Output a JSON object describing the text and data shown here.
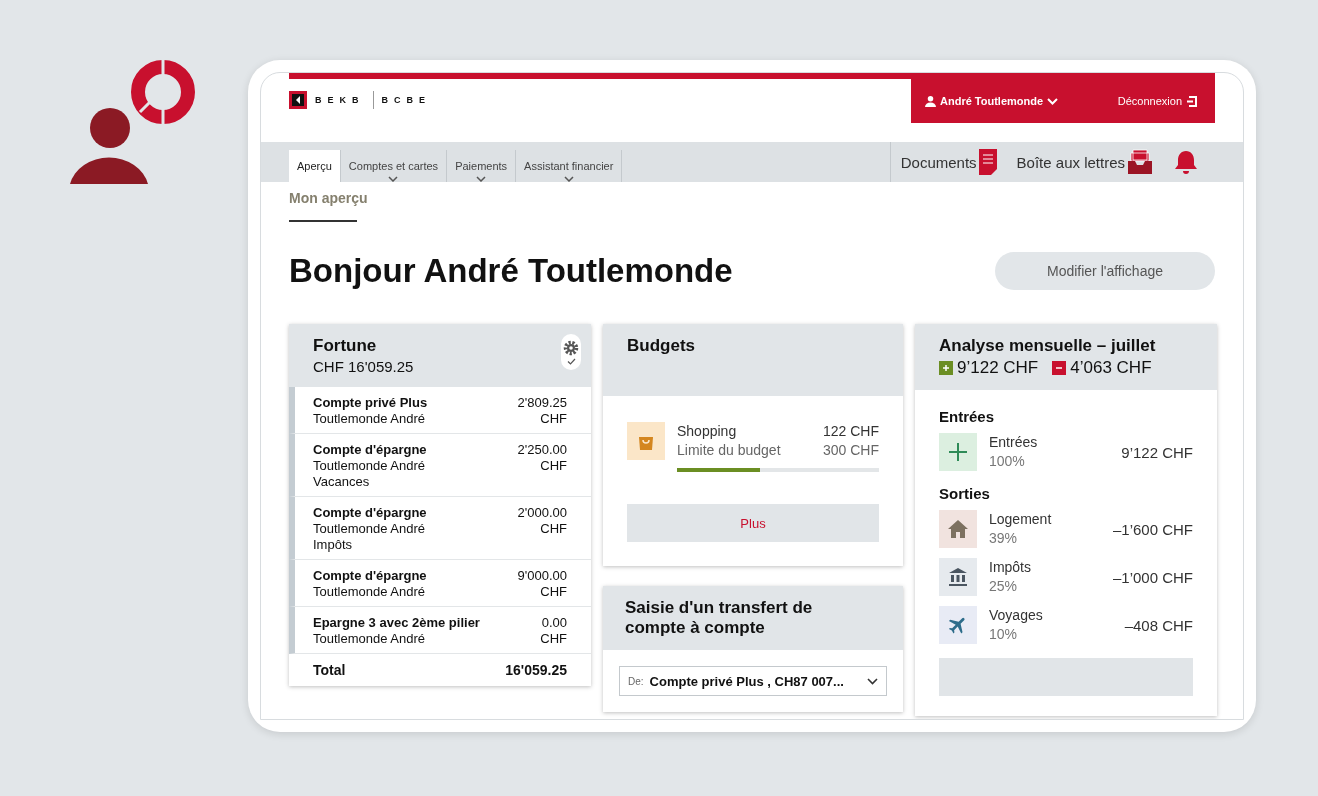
{
  "header": {
    "logo_words": [
      "BEKB",
      "BCBE"
    ],
    "user": "André Toutlemonde",
    "logout": "Déconnexion"
  },
  "nav": {
    "tabs": [
      {
        "label": "Aperçu",
        "selected": true,
        "has_menu": false
      },
      {
        "label": "Comptes et cartes",
        "selected": false,
        "has_menu": true
      },
      {
        "label": "Paiements",
        "selected": false,
        "has_menu": true
      },
      {
        "label": "Assistant financier",
        "selected": false,
        "has_menu": true
      }
    ],
    "actions": [
      {
        "kind": "documents",
        "label": "Documents"
      },
      {
        "kind": "mailbox",
        "label": "Boîte aux lettres"
      },
      {
        "kind": "notifications"
      }
    ]
  },
  "breadcrumb": "Mon aperçu",
  "greeting": "Bonjour André Toutlemonde",
  "edit_button": "Modifier l'affichage",
  "fortune": {
    "title": "Fortune",
    "total": "CHF 16'059.25",
    "accounts": [
      {
        "name": "Compte privé Plus",
        "owner": "Toutlemonde André",
        "amount": "2'809.25",
        "currency": "CHF"
      },
      {
        "name": "Compte d'épargne",
        "owner": "Toutlemonde André",
        "note": "Vacances",
        "amount": "2'250.00",
        "currency": "CHF"
      },
      {
        "name": "Compte d'épargne",
        "owner": "Toutlemonde André",
        "note": "Impôts",
        "amount": "2'000.00",
        "currency": "CHF"
      },
      {
        "name": "Compte d'épargne",
        "owner": "Toutlemonde André",
        "amount": "9'000.00",
        "currency": "CHF"
      },
      {
        "name": "Epargne 3 avec 2ème pilier",
        "owner": "Toutlemonde André",
        "amount": "0.00",
        "currency": "CHF"
      }
    ],
    "total_label": "Total",
    "total_amount": "16'059.25"
  },
  "budgets": {
    "title": "Budgets",
    "items": [
      {
        "name": "Shopping",
        "amount": "122 CHF",
        "limit_label": "Limite du budget",
        "limit": "300 CHF",
        "level": 0.41
      }
    ],
    "button": "Plus"
  },
  "transfer": {
    "title": "Saisie d'un transfert de compte à compte",
    "from_label": "De:",
    "from_value": "Compte privé Plus , CH87 007..."
  },
  "analysis": {
    "title": "Analyse mensuelle – juillet",
    "income_total": "9’122 CHF",
    "expense_total": "4’063 CHF",
    "sections": [
      {
        "heading": "Entrées",
        "items": [
          {
            "kind": "income",
            "label": "Entrées",
            "share": "100%",
            "amount": "9’122 CHF"
          }
        ]
      },
      {
        "heading": "Sorties",
        "items": [
          {
            "kind": "housing",
            "label": "Logement",
            "share": "39%",
            "amount": "–1’600 CHF"
          },
          {
            "kind": "taxes",
            "label": "Impôts",
            "share": "25%",
            "amount": "–1’000 CHF"
          },
          {
            "kind": "travel",
            "label": "Voyages",
            "share": "10%",
            "amount": "–408 CHF"
          }
        ]
      }
    ]
  }
}
